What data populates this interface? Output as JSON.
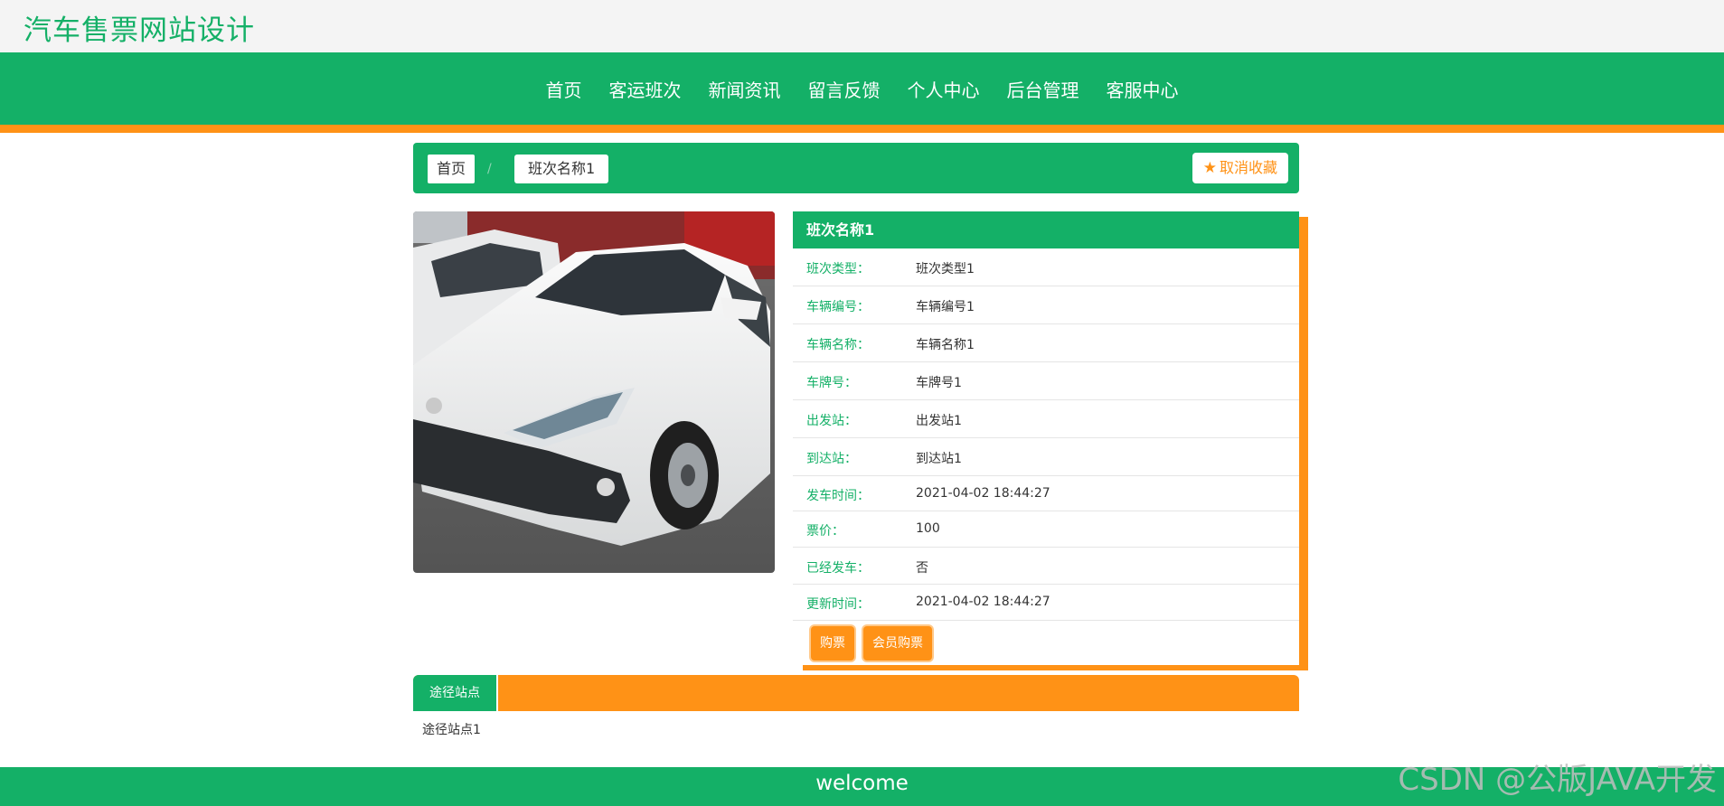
{
  "site": {
    "title": "汽车售票网站设计"
  },
  "nav": {
    "items": [
      "首页",
      "客运班次",
      "新闻资讯",
      "留言反馈",
      "个人中心",
      "后台管理",
      "客服中心"
    ]
  },
  "breadcrumb": {
    "home": "首页",
    "separator": "/",
    "current": "班次名称1"
  },
  "favorite": {
    "label": "取消收藏"
  },
  "detail": {
    "title": "班次名称1",
    "rows": [
      {
        "label": "班次类型：",
        "value": "班次类型1"
      },
      {
        "label": "车辆编号：",
        "value": "车辆编号1"
      },
      {
        "label": "车辆名称：",
        "value": "车辆名称1"
      },
      {
        "label": "车牌号：",
        "value": "车牌号1"
      },
      {
        "label": "出发站：",
        "value": "出发站1"
      },
      {
        "label": "到达站：",
        "value": "到达站1"
      },
      {
        "label": "发车时间：",
        "value": "2021-04-02 18:44:27"
      },
      {
        "label": "票价：",
        "value": "100"
      },
      {
        "label": "已经发车：",
        "value": "否"
      },
      {
        "label": "更新时间：",
        "value": "2021-04-02 18:44:27"
      }
    ],
    "buy_label": "购票",
    "member_buy_label": "会员购票"
  },
  "tabs": {
    "active": "途径站点",
    "content": "途径站点1"
  },
  "footer": {
    "text": "welcome"
  },
  "watermark": {
    "text": "CSDN @公版JAVA开发"
  },
  "colors": {
    "primary": "#14b067",
    "accent": "#ff9216"
  }
}
